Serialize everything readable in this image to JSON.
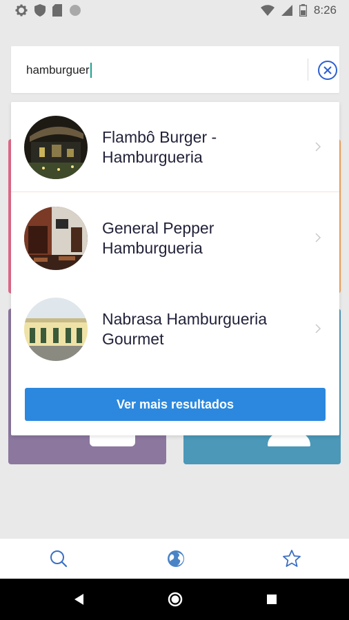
{
  "status_bar": {
    "time": "8:26",
    "icons": [
      "settings-icon",
      "shield-icon",
      "sd-card-icon",
      "circle-icon",
      "wifi-icon",
      "signal-icon",
      "battery-icon"
    ]
  },
  "search": {
    "value": "hamburguer",
    "clear_icon": "close-circle-icon"
  },
  "results": {
    "items": [
      {
        "name": "Flambô Burger - Hamburgueria",
        "thumb": "restaurant-night-photo"
      },
      {
        "name": "General Pepper Hamburgueria",
        "thumb": "restaurant-interior-photo"
      },
      {
        "name": "Nabrasa Hamburgueria Gourmet",
        "thumb": "building-facade-photo"
      }
    ],
    "more_label": "Ver mais resultados"
  },
  "bottom_nav": {
    "items": [
      "search-icon",
      "globe-icon",
      "star-icon"
    ],
    "accent": "#3a6fc4"
  },
  "colors": {
    "primary_button": "#2b88de",
    "accent_pink": "#e06b8a",
    "accent_orange": "#f2a25a",
    "card_purple": "#8c779e",
    "card_teal": "#4b98b8"
  }
}
